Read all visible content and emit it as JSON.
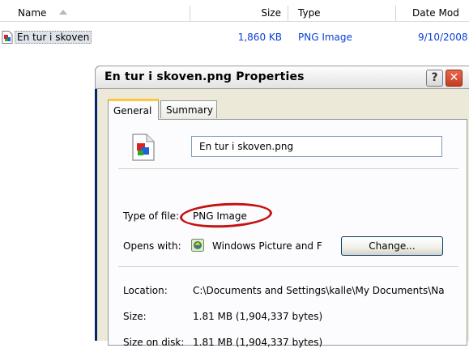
{
  "explorer": {
    "columns": {
      "name": "Name",
      "size": "Size",
      "type": "Type",
      "date": "Date Mod"
    },
    "rows": [
      {
        "name": "En tur i skoven",
        "size": "1,860 KB",
        "type": "PNG Image",
        "date": "9/10/2008"
      }
    ]
  },
  "dialog": {
    "title": "En tur i skoven.png Properties",
    "help_label": "?",
    "close_label": "✕",
    "tabs": [
      "General",
      "Summary"
    ],
    "active_tab": "General",
    "filename": "En tur i skoven.png",
    "type_label": "Type of file:",
    "type_value": "PNG Image",
    "opens_label": "Opens with:",
    "opens_value": "Windows Picture and F",
    "change_label": "Change...",
    "location_label": "Location:",
    "location_value": "C:\\Documents and Settings\\kalle\\My Documents\\Na",
    "size_label": "Size:",
    "size_value": "1.81 MB (1,904,337 bytes)",
    "size_on_disk_label": "Size on disk:",
    "size_on_disk_value": "1.81 MB (1,904,337 bytes)"
  },
  "colors": {
    "highlight_circle": "#c41313",
    "link_blue": "#0a3fd6",
    "tab_accent": "#ffc83c"
  },
  "icons": {
    "file": "png-file-icon",
    "viewer": "windows-picture-viewer-icon"
  }
}
